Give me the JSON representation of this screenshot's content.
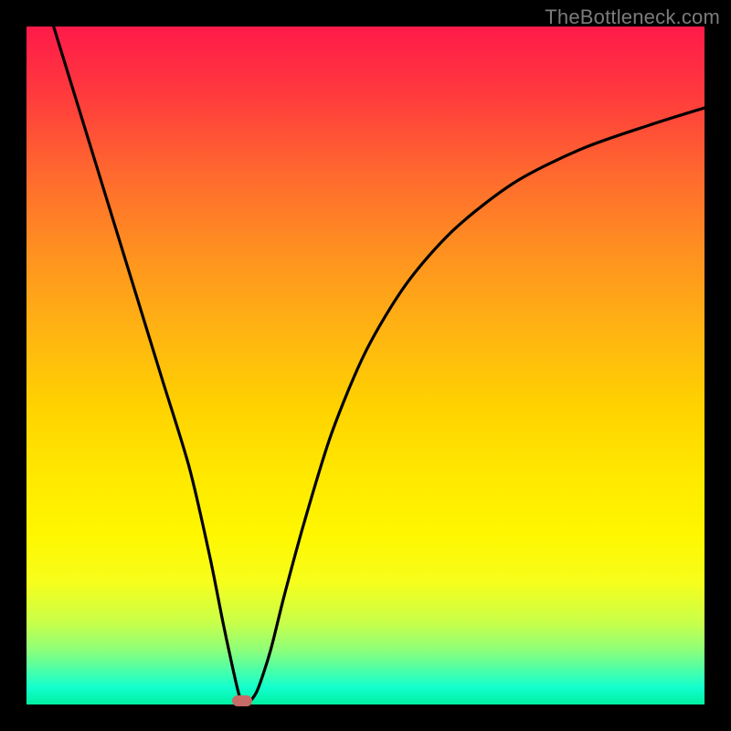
{
  "watermark": "TheBottleneck.com",
  "chart_data": {
    "type": "line",
    "title": "",
    "xlabel": "",
    "ylabel": "",
    "xlim": [
      0,
      100
    ],
    "ylim": [
      0,
      100
    ],
    "grid": false,
    "legend": false,
    "series": [
      {
        "name": "curve",
        "x": [
          4,
          8,
          12,
          16,
          20,
          24,
          27,
          29,
          30.5,
          31.5,
          32.5,
          34,
          36,
          38,
          41,
          45,
          50,
          56,
          63,
          72,
          82,
          92,
          100
        ],
        "values": [
          100,
          87,
          74,
          61,
          48,
          35,
          22,
          12,
          5,
          1,
          0.2,
          2,
          8,
          16,
          27,
          40,
          52,
          62,
          70,
          77,
          82,
          85.5,
          88
        ]
      }
    ],
    "marker": {
      "x": 31.8,
      "y": 0.5,
      "shape": "pill",
      "color": "#c66b65"
    },
    "background_gradient": {
      "type": "vertical",
      "stops": [
        {
          "pos": 0,
          "color": "#ff1a4a"
        },
        {
          "pos": 0.5,
          "color": "#ffd200"
        },
        {
          "pos": 0.82,
          "color": "#f6fe1c"
        },
        {
          "pos": 1.0,
          "color": "#00f0a0"
        }
      ]
    }
  },
  "colors": {
    "frame": "#000000",
    "curve": "#000000",
    "watermark": "#7b7b7b",
    "marker": "#c66b65"
  }
}
